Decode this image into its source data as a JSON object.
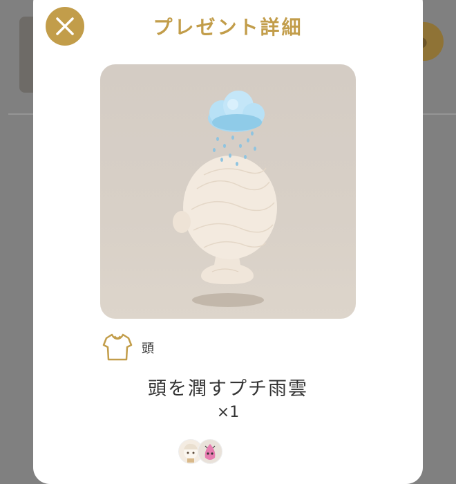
{
  "modal": {
    "title": "プレゼント詳細",
    "close_icon": "close-icon"
  },
  "item": {
    "category_icon": "shirt-icon",
    "category_label": "頭",
    "name": "頭を潤すプチ雨雲",
    "quantity": "×1"
  },
  "avatars": [
    {
      "icon": "sender-avatar"
    },
    {
      "icon": "recipient-avatar"
    }
  ],
  "colors": {
    "accent_gold": "#c29d4a",
    "overlay": "#808080",
    "image_bg": "#d6cec5"
  }
}
